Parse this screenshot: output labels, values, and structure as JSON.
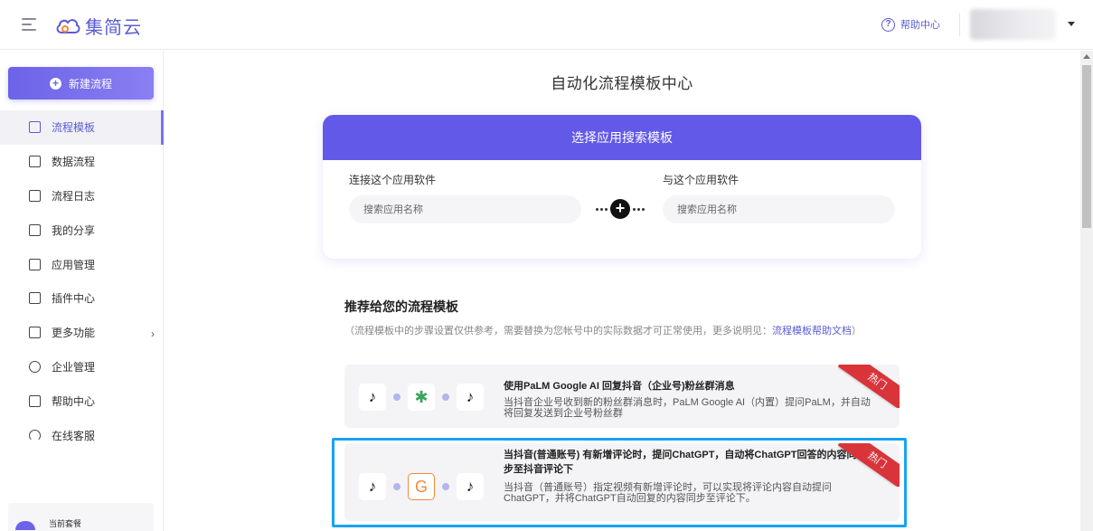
{
  "header": {
    "logo_text": "集简云",
    "help_label": "帮助中心"
  },
  "sidebar": {
    "new_flow_label": "新建流程",
    "items": [
      {
        "label": "流程模板",
        "icon": "template-icon",
        "active": true
      },
      {
        "label": "数据流程",
        "icon": "chart-icon"
      },
      {
        "label": "流程日志",
        "icon": "log-icon"
      },
      {
        "label": "我的分享",
        "icon": "share-icon"
      },
      {
        "label": "应用管理",
        "icon": "apps-icon"
      },
      {
        "label": "插件中心",
        "icon": "plugin-icon"
      },
      {
        "label": "更多功能",
        "icon": "more-icon",
        "has_submenu": true
      },
      {
        "label": "企业管理",
        "icon": "enterprise-icon"
      },
      {
        "label": "帮助中心",
        "icon": "help-icon"
      },
      {
        "label": "在线客服",
        "icon": "support-icon"
      }
    ],
    "plan_label": "当前套餐"
  },
  "main": {
    "page_title": "自动化流程模板中心",
    "search_card": {
      "header": "选择应用搜索模板",
      "left_label": "连接这个应用软件",
      "right_label": "与这个应用软件",
      "left_placeholder": "搜索应用名称",
      "right_placeholder": "搜索应用名称"
    },
    "recommend": {
      "title": "推荐给您的流程模板",
      "desc_prefix": "（流程模板中的步骤设置仅供参考，需要替换为您帐号中的实际数据才可正常使用，更多说明见：",
      "desc_link": "流程模板帮助文档",
      "desc_suffix": "）"
    },
    "templates": [
      {
        "title": "使用PaLM Google AI 回复抖音（企业号)粉丝群消息",
        "body": "当抖音企业号收到新的粉丝群消息时，PaLM Google AI（内置）提问PaLM，并自动将回复发送到企业号粉丝群",
        "badge": "热门",
        "apps": [
          "tiktok-icon",
          "palm-icon",
          "tiktok-icon"
        ]
      },
      {
        "title": "当抖音(普通账号) 有新增评论时，提问ChatGPT，自动将ChatGPT回答的内容同步至抖音评论下",
        "body": "当抖音（普通账号）指定视频有新增评论时，可以实现将评论内容自动提问ChatGPT，并将ChatGPT自动回复的内容同步至评论下。",
        "badge": "热门",
        "apps": [
          "tiktok-icon",
          "chatgpt-icon",
          "tiktok-icon"
        ],
        "chatgpt_letter": "G"
      }
    ]
  },
  "colors": {
    "brand": "#5b5bd6",
    "header_bg": "#6359e8",
    "hot_badge": "#d9343a",
    "selection": "#1aa3f0"
  }
}
